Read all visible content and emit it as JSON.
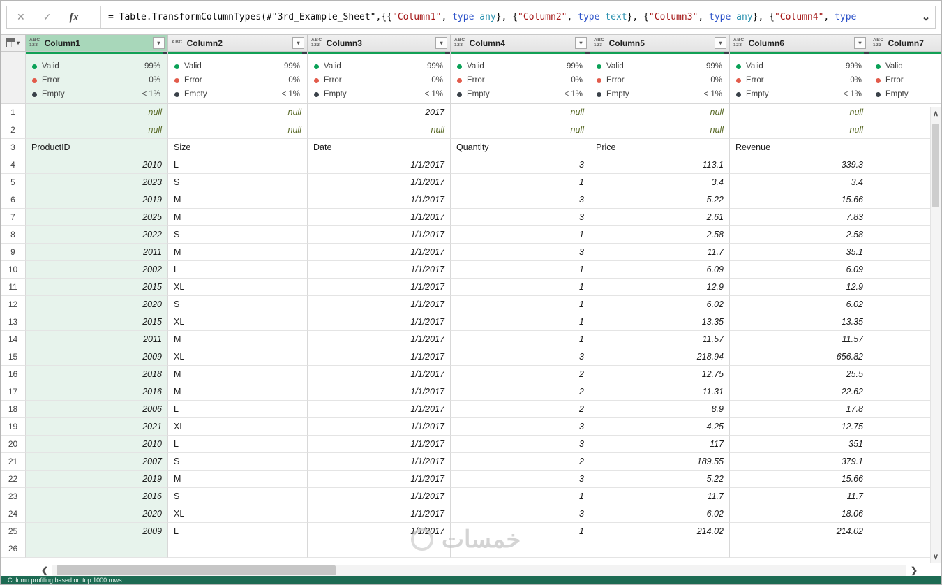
{
  "formula_bar": {
    "cancel_icon": "✕",
    "check_icon": "✓",
    "fx_icon": "fx",
    "expand_icon": "⌄",
    "tokens": [
      {
        "t": "= Table.TransformColumnTypes(#\"3rd_Example_Sheet\",{{",
        "c": "plain"
      },
      {
        "t": "\"Column1\"",
        "c": "string"
      },
      {
        "t": ", ",
        "c": "plain"
      },
      {
        "t": "type",
        "c": "keyword"
      },
      {
        "t": " ",
        "c": "plain"
      },
      {
        "t": "any",
        "c": "typename"
      },
      {
        "t": "}, {",
        "c": "plain"
      },
      {
        "t": "\"Column2\"",
        "c": "string"
      },
      {
        "t": ", ",
        "c": "plain"
      },
      {
        "t": "type",
        "c": "keyword"
      },
      {
        "t": " ",
        "c": "plain"
      },
      {
        "t": "text",
        "c": "typename"
      },
      {
        "t": "}, {",
        "c": "plain"
      },
      {
        "t": "\"Column3\"",
        "c": "string"
      },
      {
        "t": ", ",
        "c": "plain"
      },
      {
        "t": "type",
        "c": "keyword"
      },
      {
        "t": " ",
        "c": "plain"
      },
      {
        "t": "any",
        "c": "typename"
      },
      {
        "t": "}, {",
        "c": "plain"
      },
      {
        "t": "\"Column4\"",
        "c": "string"
      },
      {
        "t": ", ",
        "c": "plain"
      },
      {
        "t": "type",
        "c": "keyword"
      }
    ]
  },
  "icons": {
    "filter": "▾",
    "corner_arrow": "▾",
    "up": "∧",
    "down": "∨",
    "left": "❮",
    "right": "❯"
  },
  "type_icons": {
    "any": [
      "ABC",
      "123"
    ],
    "text": [
      "ABC"
    ]
  },
  "quality_labels": {
    "valid": "Valid",
    "error": "Error",
    "empty": "Empty"
  },
  "columns": [
    {
      "name": "Column1",
      "icon": "any",
      "selected": true,
      "valid": "99%",
      "error": "0%",
      "empty": "< 1%"
    },
    {
      "name": "Column2",
      "icon": "text",
      "selected": false,
      "valid": "99%",
      "error": "0%",
      "empty": "< 1%"
    },
    {
      "name": "Column3",
      "icon": "any",
      "selected": false,
      "valid": "99%",
      "error": "0%",
      "empty": "< 1%"
    },
    {
      "name": "Column4",
      "icon": "any",
      "selected": false,
      "valid": "99%",
      "error": "0%",
      "empty": "< 1%"
    },
    {
      "name": "Column5",
      "icon": "any",
      "selected": false,
      "valid": "99%",
      "error": "0%",
      "empty": "< 1%"
    },
    {
      "name": "Column6",
      "icon": "any",
      "selected": false,
      "valid": "99%",
      "error": "0%",
      "empty": "< 1%"
    },
    {
      "name": "Column7",
      "icon": "any",
      "selected": false,
      "valid": "",
      "error": "",
      "empty": ""
    }
  ],
  "rows": [
    {
      "n": "1",
      "cells": [
        {
          "v": "null",
          "k": "null"
        },
        {
          "v": "null",
          "k": "null"
        },
        {
          "v": "2017",
          "k": "num"
        },
        {
          "v": "null",
          "k": "null"
        },
        {
          "v": "null",
          "k": "null"
        },
        {
          "v": "null",
          "k": "null"
        },
        {
          "v": "",
          "k": "empty"
        }
      ]
    },
    {
      "n": "2",
      "cells": [
        {
          "v": "null",
          "k": "null"
        },
        {
          "v": "null",
          "k": "null"
        },
        {
          "v": "null",
          "k": "null"
        },
        {
          "v": "null",
          "k": "null"
        },
        {
          "v": "null",
          "k": "null"
        },
        {
          "v": "null",
          "k": "null"
        },
        {
          "v": "",
          "k": "empty"
        }
      ]
    },
    {
      "n": "3",
      "cells": [
        {
          "v": "ProductID",
          "k": "text"
        },
        {
          "v": "Size",
          "k": "text"
        },
        {
          "v": "Date",
          "k": "text"
        },
        {
          "v": "Quantity",
          "k": "text"
        },
        {
          "v": "Price",
          "k": "text"
        },
        {
          "v": "Revenue",
          "k": "text"
        },
        {
          "v": "",
          "k": "empty"
        }
      ]
    },
    {
      "n": "4",
      "cells": [
        {
          "v": "2010",
          "k": "num"
        },
        {
          "v": "L",
          "k": "text"
        },
        {
          "v": "1/1/2017",
          "k": "num"
        },
        {
          "v": "3",
          "k": "num"
        },
        {
          "v": "113.1",
          "k": "num"
        },
        {
          "v": "339.3",
          "k": "num"
        },
        {
          "v": "",
          "k": "empty"
        }
      ]
    },
    {
      "n": "5",
      "cells": [
        {
          "v": "2023",
          "k": "num"
        },
        {
          "v": "S",
          "k": "text"
        },
        {
          "v": "1/1/2017",
          "k": "num"
        },
        {
          "v": "1",
          "k": "num"
        },
        {
          "v": "3.4",
          "k": "num"
        },
        {
          "v": "3.4",
          "k": "num"
        },
        {
          "v": "",
          "k": "empty"
        }
      ]
    },
    {
      "n": "6",
      "cells": [
        {
          "v": "2019",
          "k": "num"
        },
        {
          "v": "M",
          "k": "text"
        },
        {
          "v": "1/1/2017",
          "k": "num"
        },
        {
          "v": "3",
          "k": "num"
        },
        {
          "v": "5.22",
          "k": "num"
        },
        {
          "v": "15.66",
          "k": "num"
        },
        {
          "v": "",
          "k": "empty"
        }
      ]
    },
    {
      "n": "7",
      "cells": [
        {
          "v": "2025",
          "k": "num"
        },
        {
          "v": "M",
          "k": "text"
        },
        {
          "v": "1/1/2017",
          "k": "num"
        },
        {
          "v": "3",
          "k": "num"
        },
        {
          "v": "2.61",
          "k": "num"
        },
        {
          "v": "7.83",
          "k": "num"
        },
        {
          "v": "",
          "k": "empty"
        }
      ]
    },
    {
      "n": "8",
      "cells": [
        {
          "v": "2022",
          "k": "num"
        },
        {
          "v": "S",
          "k": "text"
        },
        {
          "v": "1/1/2017",
          "k": "num"
        },
        {
          "v": "1",
          "k": "num"
        },
        {
          "v": "2.58",
          "k": "num"
        },
        {
          "v": "2.58",
          "k": "num"
        },
        {
          "v": "",
          "k": "empty"
        }
      ]
    },
    {
      "n": "9",
      "cells": [
        {
          "v": "2011",
          "k": "num"
        },
        {
          "v": "M",
          "k": "text"
        },
        {
          "v": "1/1/2017",
          "k": "num"
        },
        {
          "v": "3",
          "k": "num"
        },
        {
          "v": "11.7",
          "k": "num"
        },
        {
          "v": "35.1",
          "k": "num"
        },
        {
          "v": "",
          "k": "empty"
        }
      ]
    },
    {
      "n": "10",
      "cells": [
        {
          "v": "2002",
          "k": "num"
        },
        {
          "v": "L",
          "k": "text"
        },
        {
          "v": "1/1/2017",
          "k": "num"
        },
        {
          "v": "1",
          "k": "num"
        },
        {
          "v": "6.09",
          "k": "num"
        },
        {
          "v": "6.09",
          "k": "num"
        },
        {
          "v": "",
          "k": "empty"
        }
      ]
    },
    {
      "n": "11",
      "cells": [
        {
          "v": "2015",
          "k": "num"
        },
        {
          "v": "XL",
          "k": "text"
        },
        {
          "v": "1/1/2017",
          "k": "num"
        },
        {
          "v": "1",
          "k": "num"
        },
        {
          "v": "12.9",
          "k": "num"
        },
        {
          "v": "12.9",
          "k": "num"
        },
        {
          "v": "",
          "k": "empty"
        }
      ]
    },
    {
      "n": "12",
      "cells": [
        {
          "v": "2020",
          "k": "num"
        },
        {
          "v": "S",
          "k": "text"
        },
        {
          "v": "1/1/2017",
          "k": "num"
        },
        {
          "v": "1",
          "k": "num"
        },
        {
          "v": "6.02",
          "k": "num"
        },
        {
          "v": "6.02",
          "k": "num"
        },
        {
          "v": "",
          "k": "empty"
        }
      ]
    },
    {
      "n": "13",
      "cells": [
        {
          "v": "2015",
          "k": "num"
        },
        {
          "v": "XL",
          "k": "text"
        },
        {
          "v": "1/1/2017",
          "k": "num"
        },
        {
          "v": "1",
          "k": "num"
        },
        {
          "v": "13.35",
          "k": "num"
        },
        {
          "v": "13.35",
          "k": "num"
        },
        {
          "v": "",
          "k": "empty"
        }
      ]
    },
    {
      "n": "14",
      "cells": [
        {
          "v": "2011",
          "k": "num"
        },
        {
          "v": "M",
          "k": "text"
        },
        {
          "v": "1/1/2017",
          "k": "num"
        },
        {
          "v": "1",
          "k": "num"
        },
        {
          "v": "11.57",
          "k": "num"
        },
        {
          "v": "11.57",
          "k": "num"
        },
        {
          "v": "",
          "k": "empty"
        }
      ]
    },
    {
      "n": "15",
      "cells": [
        {
          "v": "2009",
          "k": "num"
        },
        {
          "v": "XL",
          "k": "text"
        },
        {
          "v": "1/1/2017",
          "k": "num"
        },
        {
          "v": "3",
          "k": "num"
        },
        {
          "v": "218.94",
          "k": "num"
        },
        {
          "v": "656.82",
          "k": "num"
        },
        {
          "v": "",
          "k": "empty"
        }
      ]
    },
    {
      "n": "16",
      "cells": [
        {
          "v": "2018",
          "k": "num"
        },
        {
          "v": "M",
          "k": "text"
        },
        {
          "v": "1/1/2017",
          "k": "num"
        },
        {
          "v": "2",
          "k": "num"
        },
        {
          "v": "12.75",
          "k": "num"
        },
        {
          "v": "25.5",
          "k": "num"
        },
        {
          "v": "",
          "k": "empty"
        }
      ]
    },
    {
      "n": "17",
      "cells": [
        {
          "v": "2016",
          "k": "num"
        },
        {
          "v": "M",
          "k": "text"
        },
        {
          "v": "1/1/2017",
          "k": "num"
        },
        {
          "v": "2",
          "k": "num"
        },
        {
          "v": "11.31",
          "k": "num"
        },
        {
          "v": "22.62",
          "k": "num"
        },
        {
          "v": "",
          "k": "empty"
        }
      ]
    },
    {
      "n": "18",
      "cells": [
        {
          "v": "2006",
          "k": "num"
        },
        {
          "v": "L",
          "k": "text"
        },
        {
          "v": "1/1/2017",
          "k": "num"
        },
        {
          "v": "2",
          "k": "num"
        },
        {
          "v": "8.9",
          "k": "num"
        },
        {
          "v": "17.8",
          "k": "num"
        },
        {
          "v": "",
          "k": "empty"
        }
      ]
    },
    {
      "n": "19",
      "cells": [
        {
          "v": "2021",
          "k": "num"
        },
        {
          "v": "XL",
          "k": "text"
        },
        {
          "v": "1/1/2017",
          "k": "num"
        },
        {
          "v": "3",
          "k": "num"
        },
        {
          "v": "4.25",
          "k": "num"
        },
        {
          "v": "12.75",
          "k": "num"
        },
        {
          "v": "",
          "k": "empty"
        }
      ]
    },
    {
      "n": "20",
      "cells": [
        {
          "v": "2010",
          "k": "num"
        },
        {
          "v": "L",
          "k": "text"
        },
        {
          "v": "1/1/2017",
          "k": "num"
        },
        {
          "v": "3",
          "k": "num"
        },
        {
          "v": "117",
          "k": "num"
        },
        {
          "v": "351",
          "k": "num"
        },
        {
          "v": "",
          "k": "empty"
        }
      ]
    },
    {
      "n": "21",
      "cells": [
        {
          "v": "2007",
          "k": "num"
        },
        {
          "v": "S",
          "k": "text"
        },
        {
          "v": "1/1/2017",
          "k": "num"
        },
        {
          "v": "2",
          "k": "num"
        },
        {
          "v": "189.55",
          "k": "num"
        },
        {
          "v": "379.1",
          "k": "num"
        },
        {
          "v": "",
          "k": "empty"
        }
      ]
    },
    {
      "n": "22",
      "cells": [
        {
          "v": "2019",
          "k": "num"
        },
        {
          "v": "M",
          "k": "text"
        },
        {
          "v": "1/1/2017",
          "k": "num"
        },
        {
          "v": "3",
          "k": "num"
        },
        {
          "v": "5.22",
          "k": "num"
        },
        {
          "v": "15.66",
          "k": "num"
        },
        {
          "v": "",
          "k": "empty"
        }
      ]
    },
    {
      "n": "23",
      "cells": [
        {
          "v": "2016",
          "k": "num"
        },
        {
          "v": "S",
          "k": "text"
        },
        {
          "v": "1/1/2017",
          "k": "num"
        },
        {
          "v": "1",
          "k": "num"
        },
        {
          "v": "11.7",
          "k": "num"
        },
        {
          "v": "11.7",
          "k": "num"
        },
        {
          "v": "",
          "k": "empty"
        }
      ]
    },
    {
      "n": "24",
      "cells": [
        {
          "v": "2020",
          "k": "num"
        },
        {
          "v": "XL",
          "k": "text"
        },
        {
          "v": "1/1/2017",
          "k": "num"
        },
        {
          "v": "3",
          "k": "num"
        },
        {
          "v": "6.02",
          "k": "num"
        },
        {
          "v": "18.06",
          "k": "num"
        },
        {
          "v": "",
          "k": "empty"
        }
      ]
    },
    {
      "n": "25",
      "cells": [
        {
          "v": "2009",
          "k": "num"
        },
        {
          "v": "L",
          "k": "text"
        },
        {
          "v": "1/1/2017",
          "k": "num"
        },
        {
          "v": "1",
          "k": "num"
        },
        {
          "v": "214.02",
          "k": "num"
        },
        {
          "v": "214.02",
          "k": "num"
        },
        {
          "v": "",
          "k": "empty"
        }
      ]
    },
    {
      "n": "26",
      "cells": [
        {
          "v": "",
          "k": "empty"
        },
        {
          "v": "",
          "k": "empty"
        },
        {
          "v": "",
          "k": "empty"
        },
        {
          "v": "",
          "k": "empty"
        },
        {
          "v": "",
          "k": "empty"
        },
        {
          "v": "",
          "k": "empty"
        },
        {
          "v": "",
          "k": "empty"
        }
      ]
    }
  ],
  "watermark": {
    "text": "خمسات"
  },
  "status_bar": {
    "text": "Column profiling based on top 1000 rows"
  }
}
